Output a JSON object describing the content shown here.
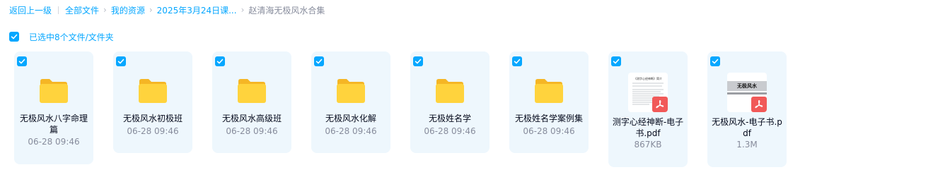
{
  "breadcrumb": {
    "back": "返回上一级",
    "items": [
      "全部文件",
      "我的资源",
      "2025年3月24日课..."
    ],
    "current": "赵清海无极风水合集"
  },
  "selection": {
    "text": "已选中8个文件/文件夹"
  },
  "files": [
    {
      "name": "无极风水八字命理篇",
      "meta": "06-28 09:46",
      "type": "folder"
    },
    {
      "name": "无极风水初极班",
      "meta": "06-28 09:46",
      "type": "folder"
    },
    {
      "name": "无极风水高级班",
      "meta": "06-28 09:46",
      "type": "folder"
    },
    {
      "name": "无极风水化解",
      "meta": "06-28 09:46",
      "type": "folder"
    },
    {
      "name": "无极姓名学",
      "meta": "06-28 09:46",
      "type": "folder"
    },
    {
      "name": "无极姓名学案例集",
      "meta": "06-28 09:46",
      "type": "folder"
    },
    {
      "name": "测字心经神断-电子书.pdf",
      "meta": "867KB",
      "type": "pdf",
      "thumb_title": "《测字心经神断》简介"
    },
    {
      "name": "无极风水-电子书.pdf",
      "meta": "1.3M",
      "type": "pdf",
      "thumb_title": "无极风水"
    }
  ],
  "colors": {
    "accent": "#06a7ff",
    "card_bg": "#eef7fd",
    "folder": "#ffd33d",
    "pdf": "#f15958"
  }
}
